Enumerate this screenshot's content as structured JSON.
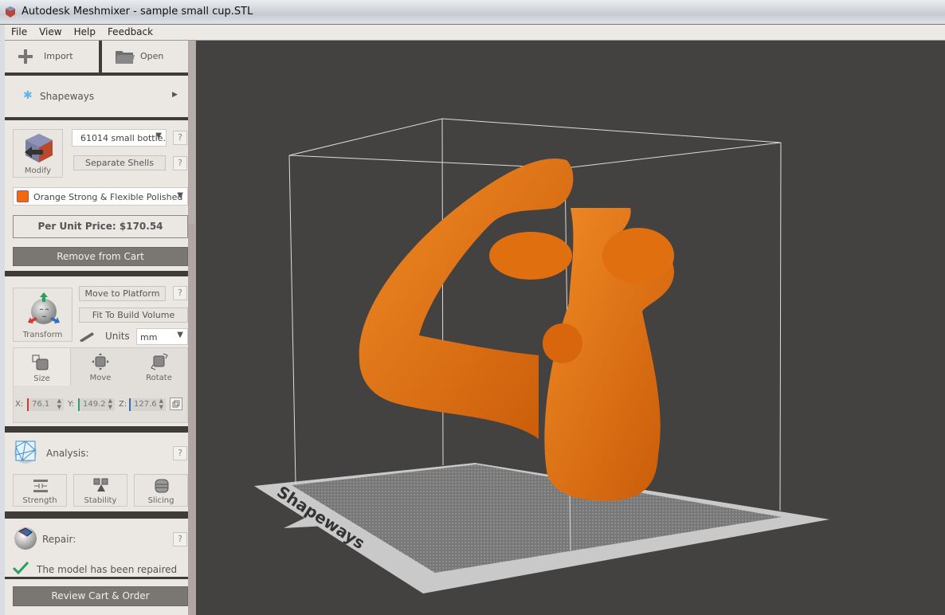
{
  "window": {
    "title": "Autodesk Meshmixer - sample small cup.STL"
  },
  "menu": [
    "File",
    "View",
    "Help",
    "Feedback"
  ],
  "top_buttons": {
    "import": "Import",
    "open": "Open"
  },
  "shapeways": {
    "label": "Shapeways"
  },
  "modify": {
    "label": "Modify",
    "model_select": "61014 small bottle.",
    "separate_shells": "Separate Shells",
    "help": "?",
    "material_select": "Orange Strong & Flexible Polished",
    "material_color": "#f26a0f",
    "price": "Per Unit Price: $170.54",
    "remove_from_cart": "Remove from Cart"
  },
  "transform": {
    "label": "Transform",
    "move_to_platform": "Move to Platform",
    "fit_to_build_volume": "Fit To Build Volume",
    "units_label": "Units",
    "units_value": "mm",
    "help": "?",
    "tabs": [
      "Size",
      "Move",
      "Rotate"
    ],
    "active_tab": "Size",
    "x_label": "X:",
    "x_value": "76.1",
    "y_label": "Y:",
    "y_value": "149.2",
    "z_label": "Z:",
    "z_value": "127.6",
    "x_color": "#d9352f",
    "y_color": "#2aa37a",
    "z_color": "#2f6fb7"
  },
  "analysis": {
    "label": "Analysis:",
    "help": "?",
    "buttons": [
      "Strength",
      "Stability",
      "Slicing"
    ]
  },
  "repair": {
    "label": "Repair:",
    "help": "?",
    "status": "The model has been repaired"
  },
  "footer": {
    "review_cart": "Review Cart & Order"
  },
  "viewport": {
    "platform_brand": "Shapeways",
    "model_color": "#e8730f",
    "background": "#444241"
  }
}
